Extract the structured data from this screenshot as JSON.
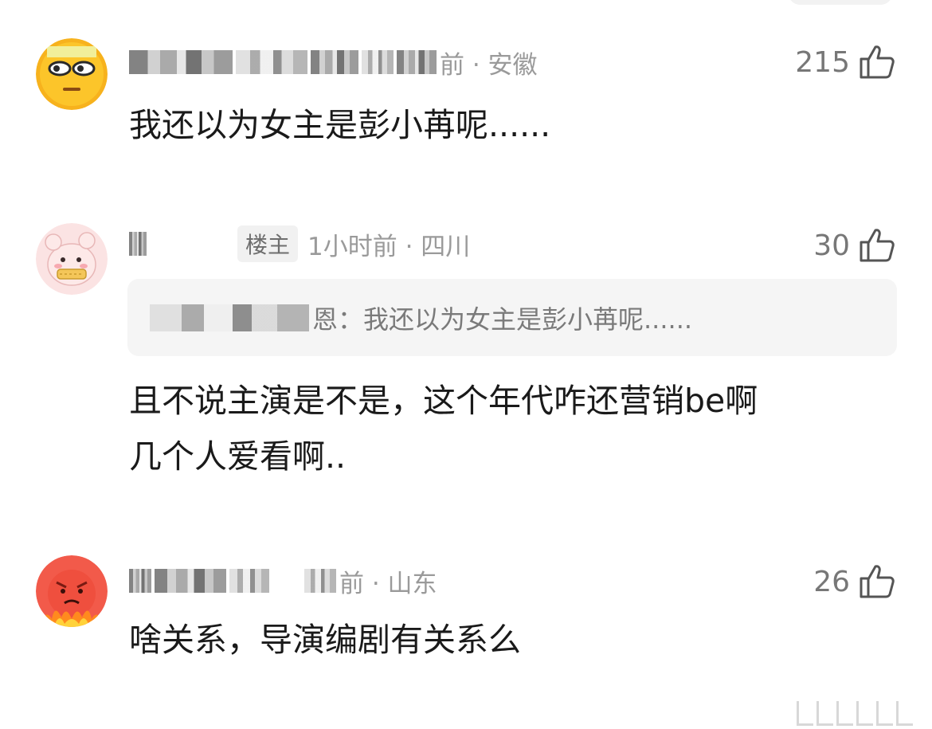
{
  "comments": [
    {
      "meta_tail": "前 · 安徽",
      "likes": "215",
      "text": "我还以为女主是彭小苒呢......",
      "avatar_icon": "sunglasses-emoji-avatar-icon"
    },
    {
      "tag": "楼主",
      "meta_tail": "1小时前 · 四川",
      "likes": "30",
      "quote_tail": "恩：我还以为女主是彭小苒呢......",
      "text_line1": "且不说主演是不是，这个年代咋还营销be啊",
      "text_line2": "几个人爱看啊..",
      "avatar_icon": "pink-cartoon-avatar-icon"
    },
    {
      "meta_tail": "前 · 山东",
      "likes": "26",
      "text": "啥关系，导演编剧有关系么",
      "avatar_icon": "angry-fire-avatar-icon"
    }
  ],
  "icons": {
    "like": "thumbs-up-icon"
  },
  "colors": {
    "text": "#1a1a1a",
    "meta": "#9a9a9a",
    "quote_bg": "#f5f5f5"
  }
}
